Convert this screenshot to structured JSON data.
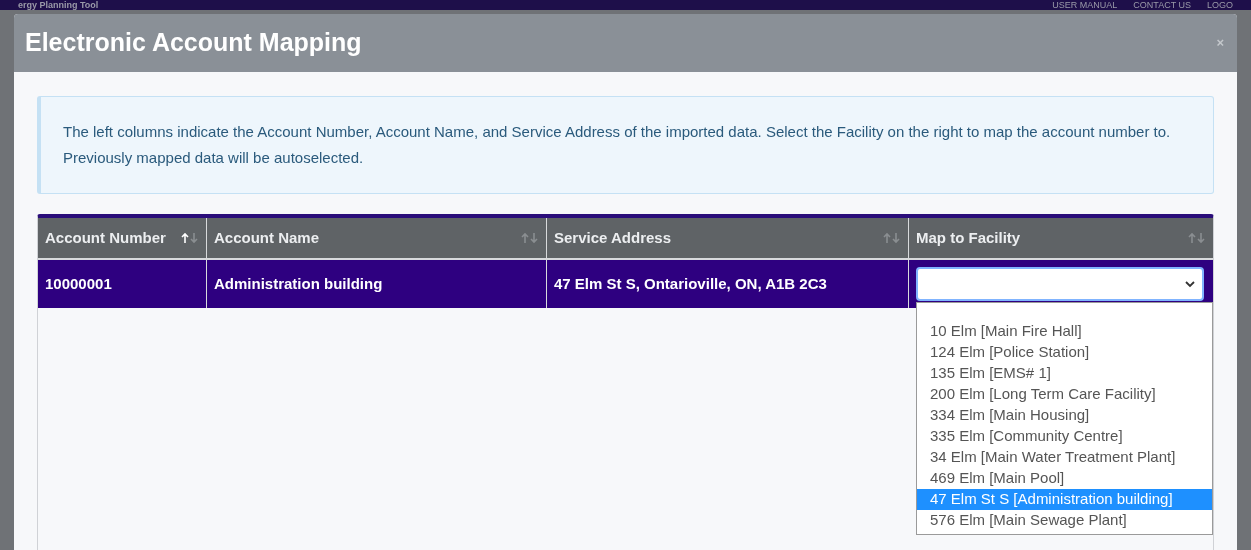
{
  "background_header": {
    "title": "ergy Planning Tool",
    "links": [
      "USER MANUAL",
      "CONTACT US",
      "LOGO"
    ]
  },
  "modal": {
    "title": "Electronic Account Mapping",
    "close": "×"
  },
  "info": "The left columns indicate the Account Number, Account Name, and Service Address of the imported data. Select the Facility on the right to map the account number to. Previously mapped data will be autoselected.",
  "table": {
    "columns": [
      {
        "label": "Account Number",
        "sorted_ascending": true
      },
      {
        "label": "Account Name",
        "sorted_ascending": false
      },
      {
        "label": "Service Address",
        "sorted_ascending": false
      },
      {
        "label": "Map to Facility",
        "sorted_ascending": false
      }
    ],
    "rows": [
      {
        "account_number": "10000001",
        "account_name": "Administration building",
        "service_address": "47 Elm St S, Ontarioville, ON, A1B 2C3",
        "selected": true
      }
    ]
  },
  "facility_dropdown": {
    "options": [
      {
        "label": "10 Elm [Main Fire Hall]",
        "selected": false
      },
      {
        "label": "124 Elm [Police Station]",
        "selected": false
      },
      {
        "label": "135 Elm [EMS# 1]",
        "selected": false
      },
      {
        "label": "200 Elm [Long Term Care Facility]",
        "selected": false
      },
      {
        "label": "334 Elm [Main Housing]",
        "selected": false
      },
      {
        "label": "335 Elm [Community Centre]",
        "selected": false
      },
      {
        "label": "34 Elm [Main Water Treatment Plant]",
        "selected": false
      },
      {
        "label": "469 Elm [Main Pool]",
        "selected": false
      },
      {
        "label": "47 Elm St S [Administration building]",
        "selected": true
      },
      {
        "label": "576 Elm [Main Sewage Plant]",
        "selected": false
      }
    ]
  }
}
